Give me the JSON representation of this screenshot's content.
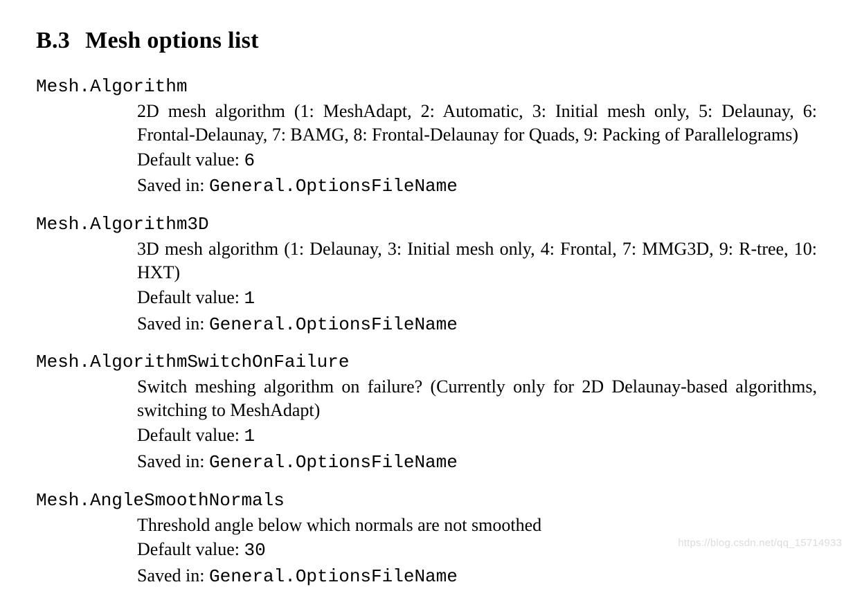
{
  "heading": {
    "number": "B.3",
    "title": "Mesh options list"
  },
  "labels": {
    "default_value": "Default value:",
    "saved_in": "Saved in:"
  },
  "options": [
    {
      "name": "Mesh.Algorithm",
      "description": "2D mesh algorithm (1: MeshAdapt, 2: Automatic, 3: Initial mesh only, 5: Delaunay, 6: Frontal-Delaunay, 7: BAMG, 8: Frontal-Delaunay for Quads, 9: Packing of Parallelograms)",
      "default_value": "6",
      "saved_in": "General.OptionsFileName"
    },
    {
      "name": "Mesh.Algorithm3D",
      "description": "3D mesh algorithm (1: Delaunay, 3: Initial mesh only, 4: Frontal, 7: MMG3D, 9: R-tree, 10: HXT)",
      "default_value": "1",
      "saved_in": "General.OptionsFileName"
    },
    {
      "name": "Mesh.AlgorithmSwitchOnFailure",
      "description": "Switch meshing algorithm on failure? (Currently only for 2D Delaunay-based algorithms, switching to MeshAdapt)",
      "default_value": "1",
      "saved_in": "General.OptionsFileName"
    },
    {
      "name": "Mesh.AngleSmoothNormals",
      "description": "Threshold angle below which normals are not smoothed",
      "default_value": "30",
      "saved_in": "General.OptionsFileName"
    }
  ],
  "watermark": "https://blog.csdn.net/qq_15714933"
}
